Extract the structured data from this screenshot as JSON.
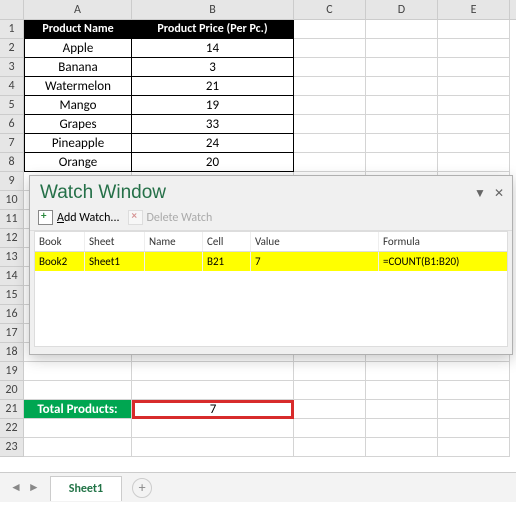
{
  "columns": [
    "A",
    "B",
    "C",
    "D",
    "E"
  ],
  "headers": {
    "a": "Product Name",
    "b": "Product Price (Per Pc.)"
  },
  "products": [
    {
      "name": "Apple",
      "price": "14"
    },
    {
      "name": "Banana",
      "price": "3"
    },
    {
      "name": "Watermelon",
      "price": "21"
    },
    {
      "name": "Mango",
      "price": "19"
    },
    {
      "name": "Grapes",
      "price": "33"
    },
    {
      "name": "Pineapple",
      "price": "24"
    },
    {
      "name": "Orange",
      "price": "20"
    }
  ],
  "totals": {
    "label": "Total Products:",
    "value": "7"
  },
  "watch": {
    "title": "Watch Window",
    "add": "Add Watch...",
    "del": "Delete Watch",
    "cols": {
      "book": "Book",
      "sheet": "Sheet",
      "name": "Name",
      "cell": "Cell",
      "value": "Value",
      "formula": "Formula"
    },
    "row": {
      "book": "Book2",
      "sheet": "Sheet1",
      "name": "",
      "cell": "B21",
      "value": "7",
      "formula": "=COUNT(B1:B20)"
    }
  },
  "tabs": {
    "sheet1": "Sheet1"
  },
  "chart_data": {
    "type": "table",
    "title": "Product Price (Per Pc.)",
    "categories": [
      "Apple",
      "Banana",
      "Watermelon",
      "Mango",
      "Grapes",
      "Pineapple",
      "Orange"
    ],
    "values": [
      14,
      3,
      21,
      19,
      33,
      24,
      20
    ],
    "total_count": 7
  }
}
